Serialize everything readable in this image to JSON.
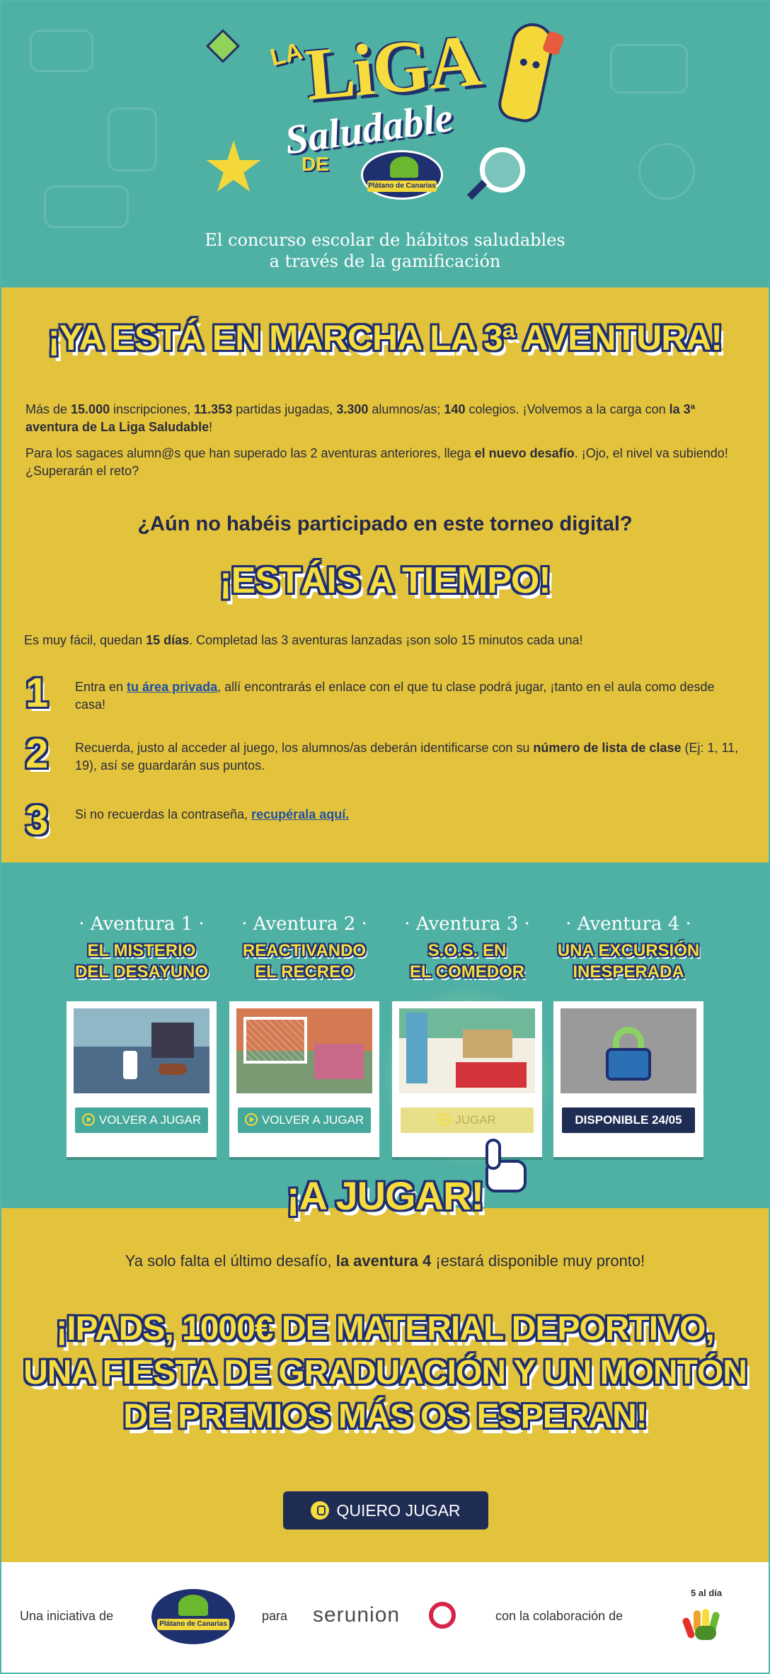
{
  "header": {
    "logo": {
      "la": "LA",
      "liga": "LiGA",
      "saludable": "Saludable",
      "de": "DE",
      "brand": "Plátano de Canarias"
    },
    "tagline_line1": "El concurso escolar de hábitos saludables",
    "tagline_line2": "a través de la gamificación"
  },
  "intro": {
    "headline": "¡YA ESTÁ EN MARCHA LA 3ª AVENTURA!",
    "p1": {
      "a": "Más de ",
      "b1": "15.000",
      "c": " inscripciones, ",
      "b2": "11.353",
      "d": " partidas jugadas, ",
      "b3": "3.300",
      "e": " alumnos/as; ",
      "b4": "140",
      "f": " colegios. ¡Volvemos a la carga con ",
      "b5": "la 3ª aventura de La Liga Saludable",
      "g": "!"
    },
    "p2": {
      "a": "Para los sagaces alumn@s que han superado las 2 aventuras anteriores, llega ",
      "b1": "el nuevo desafío",
      "c": ". ¡Ojo, el nivel va subiendo! ¿Superarán el reto?"
    },
    "question": "¿Aún no habéis participado en este torneo digital?",
    "headline2": "¡ESTÁIS A TIEMPO!",
    "p3": {
      "a": "Es muy fácil, quedan ",
      "b1": "15 días",
      "c": ". Completad las 3 aventuras lanzadas ¡son solo 15 minutos cada una!"
    }
  },
  "steps": [
    {
      "num": "1",
      "a": "Entra en ",
      "link": "tu área privada",
      "b": ", allí encontrarás el enlace con el que tu clase podrá jugar, ¡tanto en el aula como desde casa!"
    },
    {
      "num": "2",
      "a": "Recuerda, justo al acceder al juego, los alumnos/as deberán identificarse con su ",
      "bold": "número de lista de clase",
      "b": " (Ej: 1, 11, 19), así se guardarán sus puntos."
    },
    {
      "num": "3",
      "a": "Si no recuerdas la contraseña, ",
      "link": "recupérala aquí."
    }
  ],
  "adventures": [
    {
      "label": "· Aventura 1 ·",
      "title1": "EL MISTERIO",
      "title2": "DEL DESAYUNO",
      "button": "VOLVER A JUGAR",
      "state": "replay"
    },
    {
      "label": "· Aventura 2 ·",
      "title1": "REACTIVANDO",
      "title2": "EL RECREO",
      "button": "VOLVER A JUGAR",
      "state": "replay"
    },
    {
      "label": "· Aventura 3 ·",
      "title1": "S.O.S. EN",
      "title2": "EL COMEDOR",
      "button": "JUGAR",
      "state": "active"
    },
    {
      "label": "· Aventura 4 ·",
      "title1": "UNA EXCURSIÓN",
      "title2": "INESPERADA",
      "button": "DISPONIBLE 24/05",
      "state": "locked"
    }
  ],
  "play": {
    "headline": "¡A JUGAR!",
    "soon": {
      "a": "Ya solo falta el último desafío, ",
      "bold": "la aventura 4",
      "b": " ¡estará disponible muy pronto!"
    },
    "prizes_line1": "¡IPADS, 1000€ DE MATERIAL DEPORTIVO,",
    "prizes_line2": "UNA FIESTA DE GRADUACIÓN Y UN MONTÓN",
    "prizes_line3": "DE PREMIOS MÁS OS ESPERAN!",
    "cta": "QUIERO JUGAR"
  },
  "footer": {
    "initiative": "Una iniciativa de",
    "para": "para",
    "serunion": "serunion",
    "collab": "con la colaboración de",
    "saldia": "5 al día"
  },
  "colors": {
    "teal": "#4fb0a4",
    "yellow": "#e3c33c",
    "navy": "#1f2d55",
    "accent_yellow": "#f6dc3d"
  },
  "icons": [
    "star-icon",
    "magnifier-icon",
    "banana-mascot-icon",
    "play-icon",
    "lock-icon",
    "pointer-hand-icon",
    "power-icon"
  ]
}
